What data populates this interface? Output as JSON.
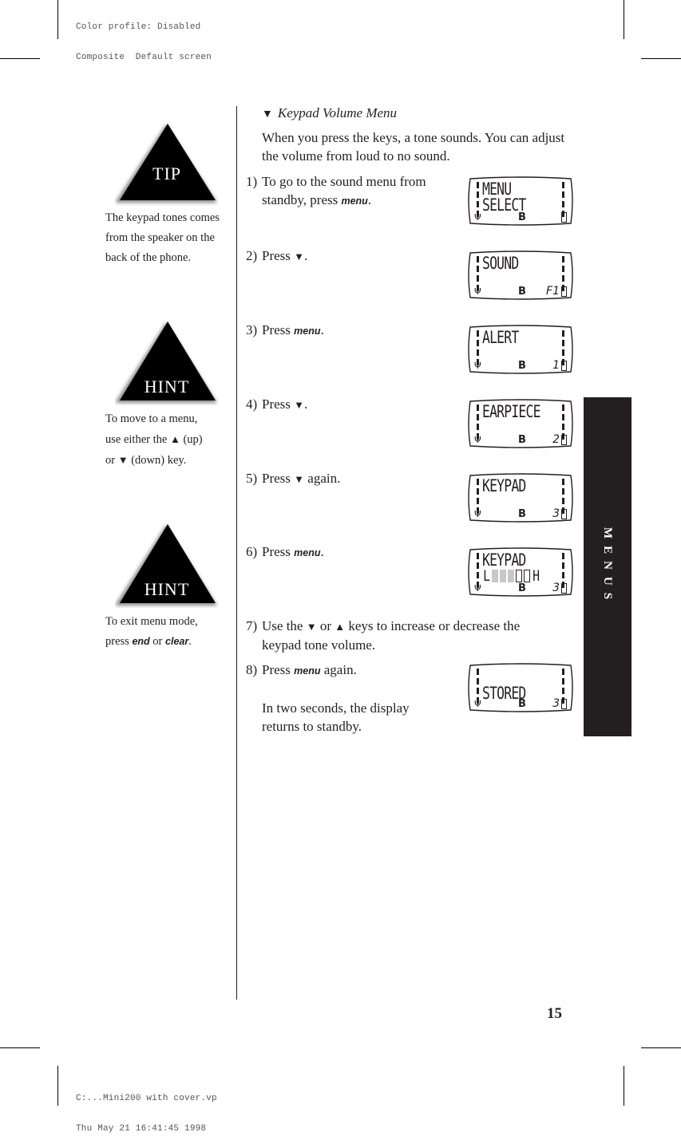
{
  "slug_top": {
    "line1": "Color profile: Disabled",
    "line2": "Composite  Default screen"
  },
  "slug_bottom": {
    "line1": "C:...Mini200 with cover.vp",
    "line2": "Thu May 21 16:41:45 1998"
  },
  "sidebar": {
    "tips": [
      {
        "badge": "TIP",
        "icon": "warning-triangle-icon",
        "text_lines": [
          "The keypad tones comes",
          "from the speaker on the",
          "back of the phone."
        ]
      },
      {
        "badge": "HINT",
        "icon": "warning-triangle-icon",
        "line1": "To move to a menu,",
        "line2_pre": "use either the ",
        "line2_glyph": "▲",
        "line2_post": " (up)",
        "line3_pre": "or ",
        "line3_glyph": "▼",
        "line3_post": " (down) key."
      },
      {
        "badge": "HINT",
        "icon": "warning-triangle-icon",
        "line1": "To exit menu mode,",
        "line2_pre": "press ",
        "key1": "end",
        "mid": " or ",
        "key2": "clear",
        "end": "."
      }
    ]
  },
  "section": {
    "bullet": "▼",
    "title": "Keypad Volume Menu",
    "intro": "When you press the keys, a tone sounds. You can adjust the volume from loud to no sound."
  },
  "steps": [
    {
      "num": "1)",
      "line1": "To go to the sound menu from",
      "pre": "standby, press ",
      "key": "menu",
      "post": "."
    },
    {
      "num": "2)",
      "pre": "Press ",
      "glyph": "▼",
      "post": "."
    },
    {
      "num": "3)",
      "pre": "Press ",
      "key": "menu",
      "post": "."
    },
    {
      "num": "4)",
      "pre": "Press ",
      "glyph": "▼",
      "post": "."
    },
    {
      "num": "5)",
      "pre": "Press ",
      "glyph": "▼",
      "post": " again."
    },
    {
      "num": "6)",
      "pre": "Press ",
      "key": "menu",
      "post": "."
    },
    {
      "num": "7)",
      "pre": "Use the ",
      "glyph1": "▼",
      "mid": " or ",
      "glyph2": "▲",
      "post": " keys to increase or decrease the",
      "line2": "keypad tone volume."
    },
    {
      "num": "8)",
      "pre": "Press ",
      "key": "menu",
      "post": " again.",
      "note1": "In two seconds, the display",
      "note2": "returns to standby."
    }
  ],
  "displays": [
    {
      "line1": "MENU",
      "line2": "SELECT",
      "indicator": "B",
      "number": ""
    },
    {
      "line1": "SOUND",
      "line2": "",
      "indicator": "B",
      "number": "F1"
    },
    {
      "line1": "ALERT",
      "line2": "",
      "indicator": "B",
      "number": "1"
    },
    {
      "line1": "EARPIECE",
      "line2": "",
      "indicator": "B",
      "number": "2"
    },
    {
      "line1": "KEYPAD",
      "line2": "",
      "indicator": "B",
      "number": "3"
    },
    {
      "line1": "KEYPAD",
      "volume": {
        "low_label": "L",
        "high_label": "H",
        "level": 3,
        "max": 5
      },
      "indicator": "B",
      "number": "3"
    },
    {
      "line1": "",
      "line2": "STORED",
      "indicator": "B",
      "number": "3"
    }
  ],
  "side_tab": {
    "label": "MENUS"
  },
  "page_number": "15"
}
